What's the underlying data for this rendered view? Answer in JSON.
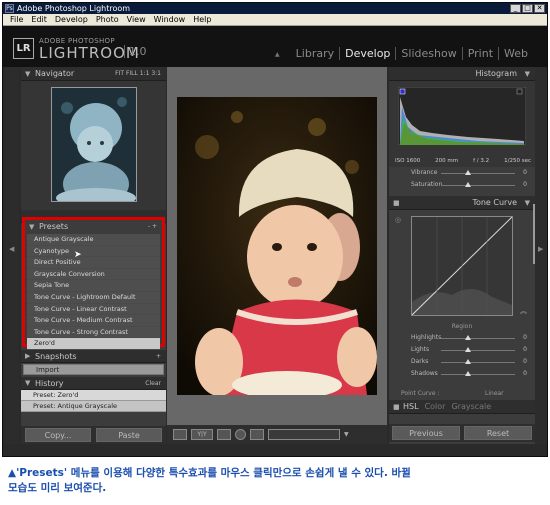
{
  "window": {
    "title": "Adobe Photoshop Lightroom",
    "app_icon": "Ps"
  },
  "window_buttons": {
    "minimize": "_",
    "maximize": "□",
    "close": "✕"
  },
  "menu": [
    "File",
    "Edit",
    "Develop",
    "Photo",
    "View",
    "Window",
    "Help"
  ],
  "identity": {
    "badge": "LR",
    "brand_small": "ADOBE PHOTOSHOP",
    "brand_big": "LIGHTROOM",
    "version": "1.0"
  },
  "modules": [
    "Library",
    "Develop",
    "Slideshow",
    "Print",
    "Web"
  ],
  "active_module": "Develop",
  "navigator": {
    "title": "Navigator",
    "zoom_options": [
      "FIT",
      "FILL",
      "1:1",
      "3:1"
    ]
  },
  "presets": {
    "title": "Presets",
    "controls": "- +",
    "items": [
      "Antique Grayscale",
      "Cyanotype",
      "Direct Positive",
      "Grayscale Conversion",
      "Sepia Tone",
      "Tone Curve - Lightroom Default",
      "Tone Curve - Linear Contrast",
      "Tone Curve - Medium Contrast",
      "Tone Curve - Strong Contrast",
      "Zero'd"
    ],
    "selected": "Zero'd"
  },
  "snapshots": {
    "title": "Snapshots",
    "controls": "+"
  },
  "import_button": "Import",
  "history": {
    "title": "History",
    "clear": "Clear",
    "items": [
      "Preset: Zero'd",
      "Preset: Antique Grayscale"
    ]
  },
  "left_buttons": {
    "copy": "Copy...",
    "paste": "Paste"
  },
  "histogram": {
    "title": "Histogram",
    "iso": "ISO 1600",
    "focal": "200 mm",
    "aperture": "f / 3.2",
    "shutter": "1/250 sec"
  },
  "basic": {
    "vibrance_label": "Vibrance",
    "vibrance_value": "0",
    "saturation_label": "Saturation",
    "saturation_value": "0"
  },
  "tone_curve": {
    "title": "Tone Curve",
    "region_label": "Region",
    "sliders": [
      {
        "label": "Highlights",
        "value": "0"
      },
      {
        "label": "Lights",
        "value": "0"
      },
      {
        "label": "Darks",
        "value": "0"
      },
      {
        "label": "Shadows",
        "value": "0"
      }
    ],
    "point_curve_label": "Point Curve :",
    "point_curve_value": "Linear"
  },
  "hsl_tabs": [
    "HSL",
    "Color",
    "Grayscale"
  ],
  "right_buttons": {
    "previous": "Previous",
    "reset": "Reset"
  },
  "toolbar": {
    "view_label": "Y|Y"
  },
  "caption": {
    "line1": "▲'Presets' 메뉴를 이용해 다양한 특수효과를 마우스 클릭만으로 손쉽게 낼 수 있다. 바뀔",
    "line2": "모습도 미리 보여준다."
  },
  "colors": {
    "highlight_border": "#e00000",
    "caption": "#1b4fae",
    "panel_bg": "#3c3c3c"
  }
}
